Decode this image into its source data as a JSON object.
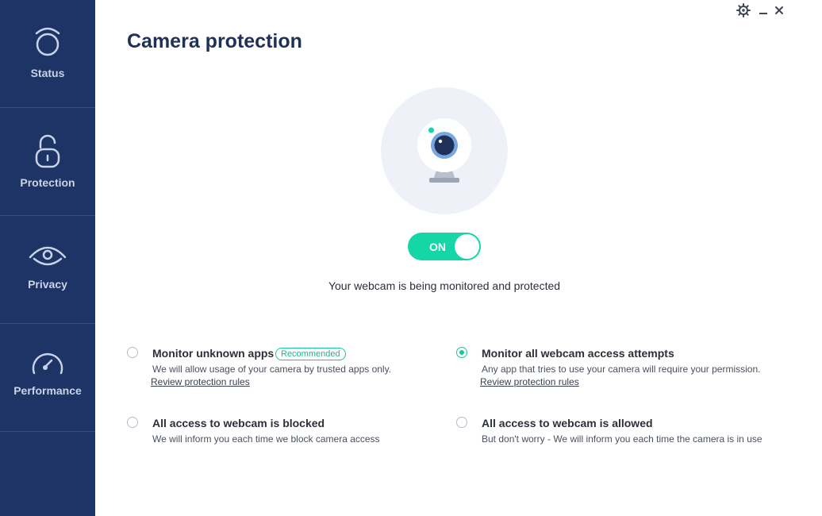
{
  "sidebar": {
    "items": [
      {
        "label": "Status",
        "icon": "status-ring-icon"
      },
      {
        "label": "Protection",
        "icon": "unlocked-padlock-icon"
      },
      {
        "label": "Privacy",
        "icon": "eye-icon"
      },
      {
        "label": "Performance",
        "icon": "gauge-icon"
      }
    ]
  },
  "window_controls": {
    "settings_icon": "gear-icon",
    "minimize_icon": "minimize-icon",
    "close_icon": "close-icon"
  },
  "main": {
    "title": "Camera protection",
    "webcam_icon": "webcam-icon",
    "toggle": {
      "label": "ON",
      "state": "on"
    },
    "status_text": "Your webcam is being monitored and protected",
    "options": [
      {
        "title": "Monitor unknown apps",
        "badge": "Recommended",
        "desc": "We will allow usage of your camera by trusted apps only.",
        "link": "Review protection rules",
        "selected": false
      },
      {
        "title": "Monitor all webcam access attempts",
        "desc": "Any app that tries to use your camera will require your permission.",
        "link": "Review protection rules",
        "selected": true
      },
      {
        "title": "All access to webcam is blocked",
        "desc": "We will inform you each time we block camera access",
        "selected": false
      },
      {
        "title": "All access to webcam is allowed",
        "desc": "But don't worry - We will inform you each time the camera is in use",
        "selected": false
      }
    ]
  },
  "colors": {
    "sidebar_bg": "#1e3466",
    "accent": "#15d6a6",
    "title": "#1f3059"
  }
}
